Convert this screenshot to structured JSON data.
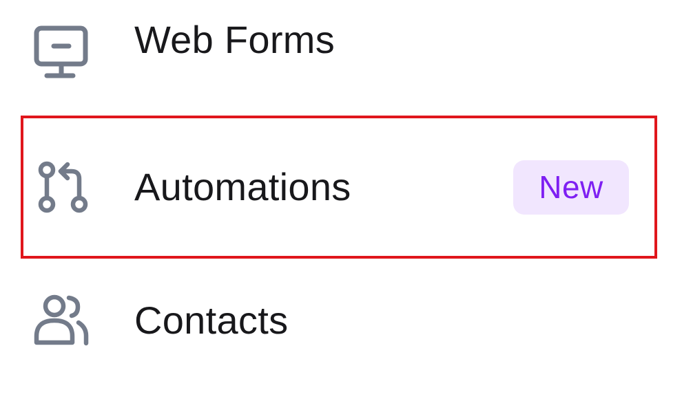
{
  "nav": {
    "items": [
      {
        "label": "Web Forms",
        "icon": "monitor-icon"
      },
      {
        "label": "Automations",
        "icon": "git-pull-request-icon",
        "badge": "New",
        "highlighted": true
      },
      {
        "label": "Contacts",
        "icon": "users-icon"
      }
    ]
  },
  "colors": {
    "icon": "#737b8a",
    "text": "#18181b",
    "highlight_border": "#e0161c",
    "badge_bg": "#f1e6fe",
    "badge_text": "#7e1ff2"
  }
}
